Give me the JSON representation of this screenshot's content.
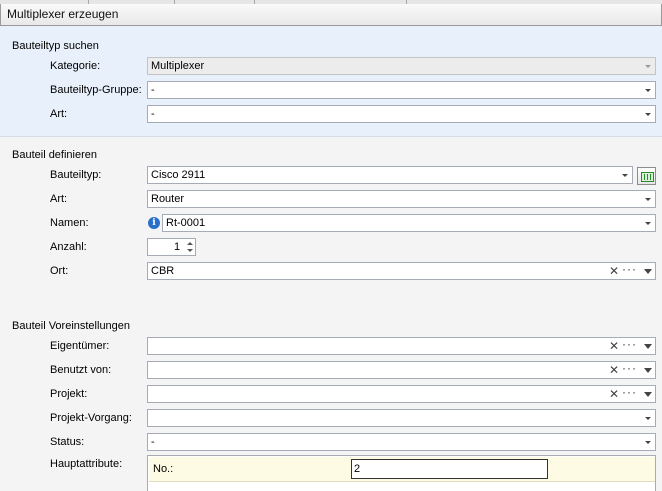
{
  "window": {
    "title": "Multiplexer erzeugen"
  },
  "section_search": {
    "title": "Bauteiltyp suchen",
    "kategorie": {
      "label": "Kategorie:",
      "value": "Multiplexer"
    },
    "gruppe": {
      "label": "Bauteiltyp-Gruppe:",
      "value": "-"
    },
    "art": {
      "label": "Art:",
      "value": "-"
    }
  },
  "section_define": {
    "title": "Bauteil definieren",
    "bauteiltyp": {
      "label": "Bauteiltyp:",
      "value": "Cisco 2911"
    },
    "art": {
      "label": "Art:",
      "value": "Router"
    },
    "namen": {
      "label": "Namen:",
      "value": "Rt-0001"
    },
    "anzahl": {
      "label": "Anzahl:",
      "value": "1"
    },
    "ort": {
      "label": "Ort:",
      "value": "CBR"
    }
  },
  "section_defaults": {
    "title": "Bauteil Voreinstellungen",
    "eigentuemer": {
      "label": "Eigentümer:",
      "value": ""
    },
    "benutzt_von": {
      "label": "Benutzt von:",
      "value": ""
    },
    "projekt": {
      "label": "Projekt:",
      "value": ""
    },
    "projekt_vorgang": {
      "label": "Projekt-Vorgang:",
      "value": ""
    },
    "status": {
      "label": "Status:",
      "value": "-"
    },
    "hauptattribute": {
      "label": "Hauptattribute:",
      "rows": [
        {
          "key": "No.:",
          "value": "2"
        }
      ]
    }
  },
  "glyphs": {
    "clear": "✕",
    "more": "···",
    "info": "i"
  },
  "colors": {
    "section_highlight": "#e8f0fb",
    "attr_row": "#fdfbe3",
    "info_blue": "#2a6fc9"
  }
}
